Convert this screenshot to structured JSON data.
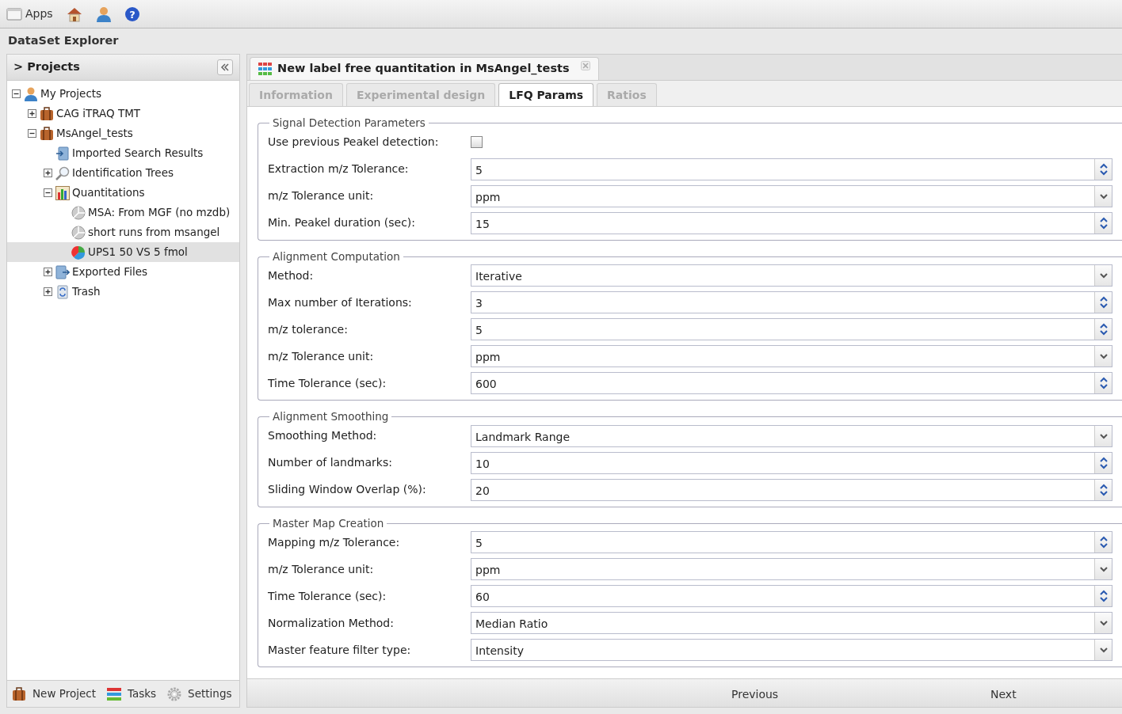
{
  "top_bar": {
    "apps_label": "Apps",
    "help_label": "?"
  },
  "window": {
    "title": "DataSet Explorer"
  },
  "sidebar": {
    "title": "> Projects",
    "tree": [
      {
        "label": "My Projects",
        "kind": "person",
        "expanded": true,
        "selected": false,
        "children": [
          {
            "label": "CAG iTRAQ TMT",
            "kind": "briefcase",
            "expanded": false,
            "selected": false
          },
          {
            "label": "MsAngel_tests",
            "kind": "briefcase",
            "expanded": true,
            "selected": false,
            "children": [
              {
                "label": "Imported Search Results",
                "kind": "import",
                "selected": false
              },
              {
                "label": "Identification Trees",
                "kind": "magnifier",
                "expanded": false,
                "selected": false
              },
              {
                "label": "Quantitations",
                "kind": "bar-chart",
                "expanded": true,
                "selected": false,
                "children": [
                  {
                    "label": "MSA: From MGF (no mzdb)",
                    "kind": "pie-grey",
                    "selected": false
                  },
                  {
                    "label": "short runs from msangel",
                    "kind": "pie-grey",
                    "selected": false
                  },
                  {
                    "label": "UPS1 50 VS 5 fmol",
                    "kind": "pie-color",
                    "selected": true
                  }
                ]
              },
              {
                "label": "Exported Files",
                "kind": "export",
                "expanded": false,
                "selected": false
              },
              {
                "label": "Trash",
                "kind": "trash",
                "expanded": false,
                "selected": false
              }
            ]
          }
        ]
      }
    ],
    "footer_buttons": [
      {
        "label": "New Project",
        "kind": "briefcase"
      },
      {
        "label": "Tasks",
        "kind": "tasks"
      },
      {
        "label": "Settings",
        "kind": "gear"
      }
    ]
  },
  "document_tab": {
    "title": "New label free quantitation in MsAngel_tests"
  },
  "tabs": [
    {
      "label": "Information",
      "selected": false
    },
    {
      "label": "Experimental design",
      "selected": false
    },
    {
      "label": "LFQ Params",
      "selected": true
    },
    {
      "label": "Ratios",
      "selected": false
    }
  ],
  "sections": [
    {
      "legend": "Signal Detection Parameters",
      "fields": [
        {
          "label": "Use previous Peakel detection:",
          "kind": "checkbox",
          "checked": false
        },
        {
          "label": "Extraction m/z Tolerance:",
          "kind": "spinner",
          "value": "5"
        },
        {
          "label": "m/z Tolerance unit:",
          "kind": "select",
          "value": "ppm"
        },
        {
          "label": "Min. Peakel duration (sec):",
          "kind": "spinner",
          "value": "15"
        }
      ]
    },
    {
      "legend": "Alignment Computation",
      "fields": [
        {
          "label": "Method:",
          "kind": "select",
          "value": "Iterative"
        },
        {
          "label": "Max number of Iterations:",
          "kind": "spinner",
          "value": "3"
        },
        {
          "label": "m/z tolerance:",
          "kind": "spinner",
          "value": "5"
        },
        {
          "label": "m/z Tolerance unit:",
          "kind": "select",
          "value": "ppm"
        },
        {
          "label": "Time Tolerance (sec):",
          "kind": "spinner",
          "value": "600"
        }
      ]
    },
    {
      "legend": "Alignment Smoothing",
      "fields": [
        {
          "label": "Smoothing Method:",
          "kind": "select",
          "value": "Landmark Range"
        },
        {
          "label": "Number of landmarks:",
          "kind": "spinner",
          "value": "10"
        },
        {
          "label": "Sliding Window Overlap (%):",
          "kind": "spinner",
          "value": "20"
        }
      ]
    },
    {
      "legend": "Master Map Creation",
      "fields": [
        {
          "label": "Mapping m/z Tolerance:",
          "kind": "spinner",
          "value": "5"
        },
        {
          "label": "m/z Tolerance unit:",
          "kind": "select",
          "value": "ppm"
        },
        {
          "label": "Time Tolerance (sec):",
          "kind": "spinner",
          "value": "60"
        },
        {
          "label": "Normalization Method:",
          "kind": "select",
          "value": "Median Ratio"
        },
        {
          "label": "Master feature filter type:",
          "kind": "select",
          "value": "Intensity"
        }
      ]
    }
  ],
  "nav_buttons": [
    "Previous",
    "Next"
  ]
}
